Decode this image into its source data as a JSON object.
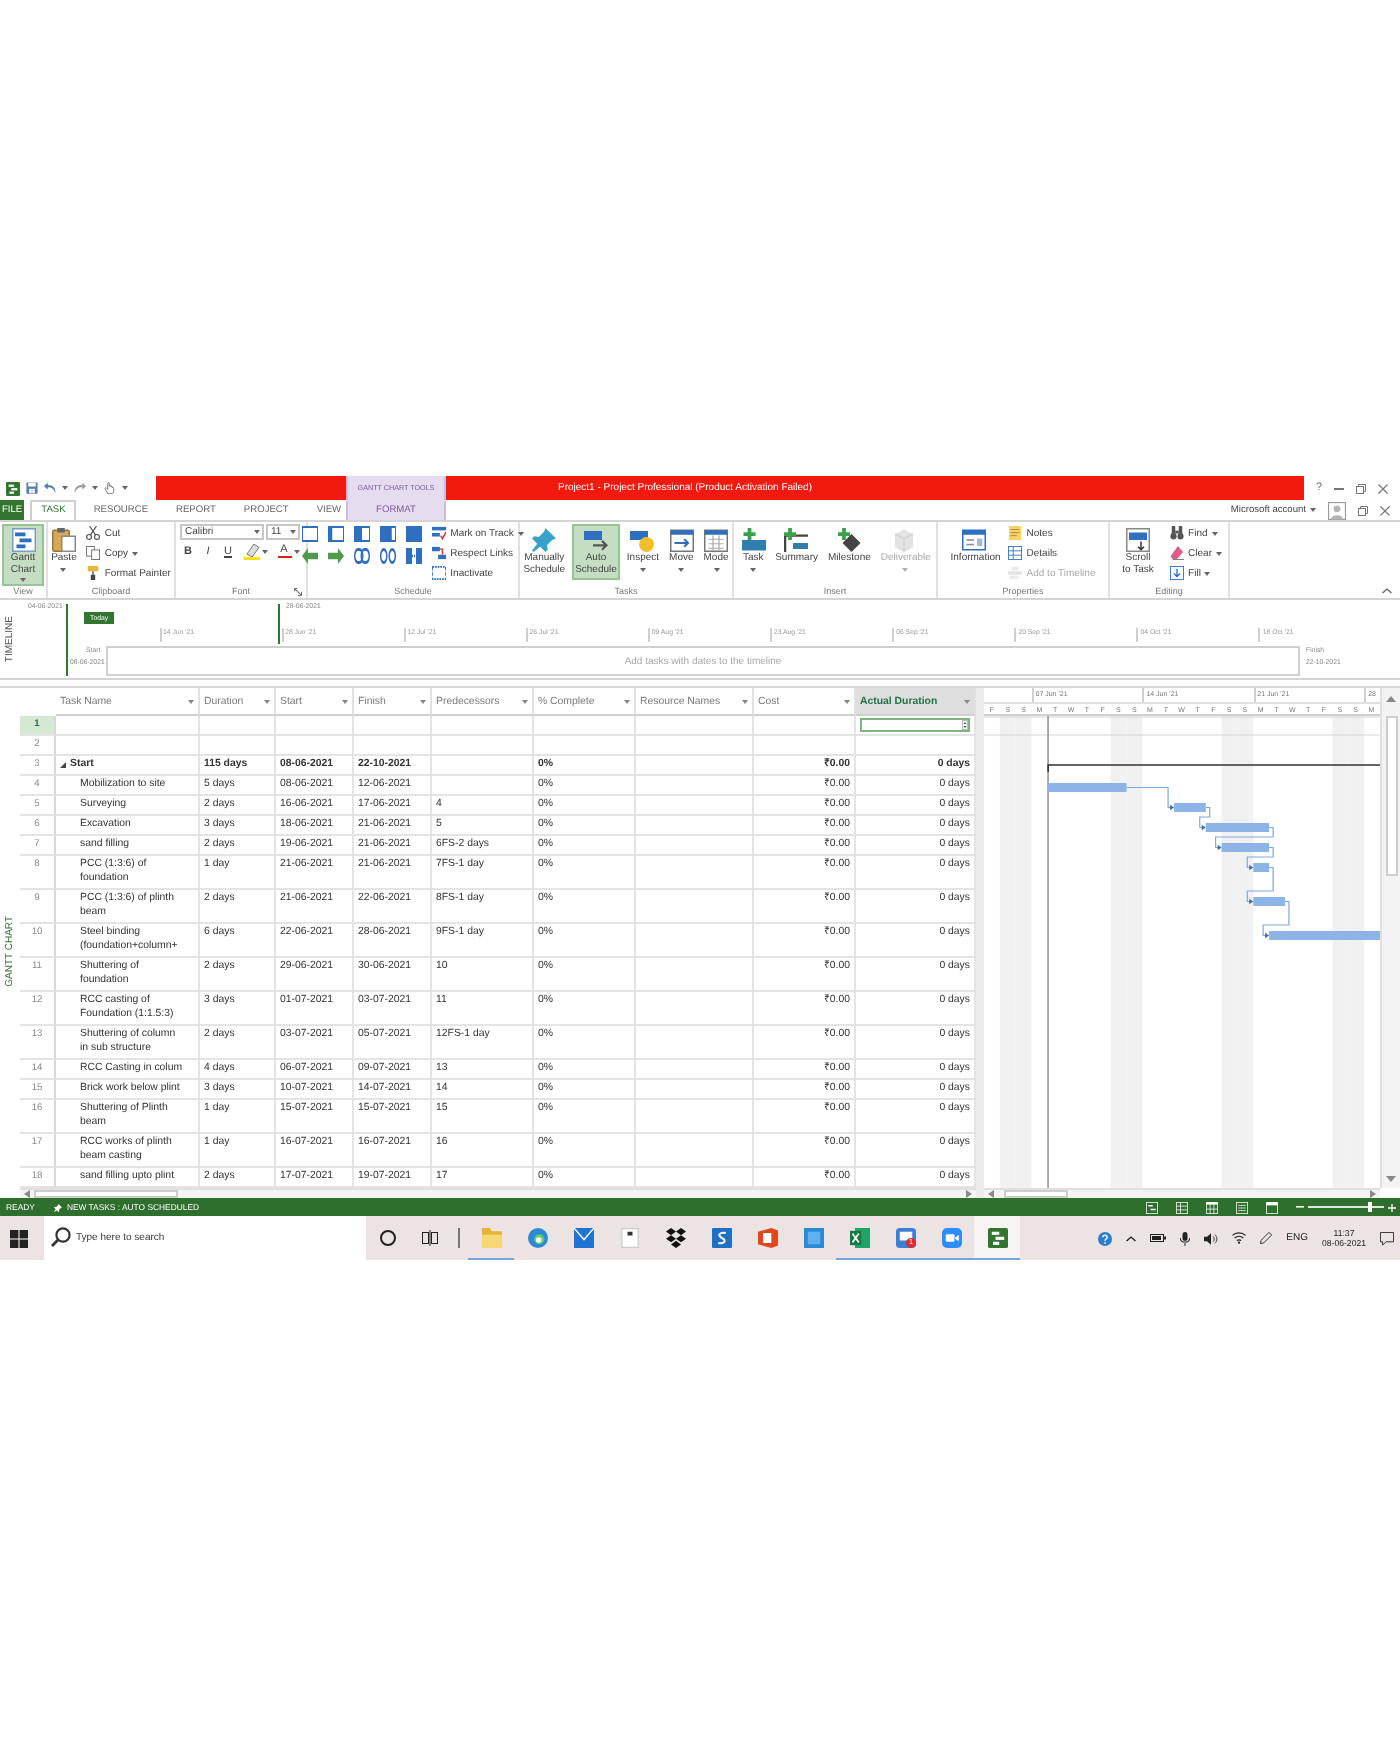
{
  "title_bar": {
    "contextual_group": "GANTT CHART TOOLS",
    "title": "Project1 - Project Professional (Product Activation Failed)",
    "help": "?"
  },
  "ribbon_tabs": [
    {
      "label": "FILE",
      "kind": "file",
      "selected": false
    },
    {
      "label": "TASK",
      "kind": "tab",
      "selected": true
    },
    {
      "label": "RESOURCE",
      "kind": "tab",
      "selected": false
    },
    {
      "label": "REPORT",
      "kind": "tab",
      "selected": false
    },
    {
      "label": "PROJECT",
      "kind": "tab",
      "selected": false
    },
    {
      "label": "VIEW",
      "kind": "tab",
      "selected": false
    },
    {
      "label": "FORMAT",
      "kind": "contextual",
      "selected": false
    }
  ],
  "account": {
    "label": "Microsoft account"
  },
  "ribbon": {
    "groups": [
      {
        "label": "View",
        "launcher": false,
        "columns": [
          [
            {
              "kind": "large",
              "label": "Gantt Chart",
              "menu": true,
              "on": true,
              "disabled": false
            }
          ]
        ]
      },
      {
        "label": "Clipboard",
        "launcher": false,
        "columns": [
          [
            {
              "kind": "large",
              "label": "Paste",
              "menu": true,
              "on": false,
              "disabled": false
            }
          ],
          [
            {
              "kind": "small",
              "label": "Cut",
              "menu": false,
              "on": false,
              "disabled": false
            },
            {
              "kind": "small",
              "label": "Copy",
              "menu": true,
              "on": false,
              "disabled": false
            },
            {
              "kind": "small",
              "label": "Format Painter",
              "menu": false,
              "on": false,
              "disabled": false
            }
          ]
        ]
      },
      {
        "label": "Font",
        "launcher": true,
        "columns": [
          [
            {
              "kind": "row",
              "items": [
                {
                  "kind": "combo",
                  "value": "Calibri"
                },
                {
                  "kind": "combo",
                  "value": "11"
                }
              ]
            },
            {
              "kind": "row",
              "items": [
                {
                  "kind": "bold",
                  "label": "B"
                },
                {
                  "kind": "italic",
                  "label": "I"
                },
                {
                  "kind": "underline",
                  "label": "U"
                },
                {
                  "kind": "icon",
                  "menu": true
                },
                {
                  "kind": "font-color",
                  "label": "A",
                  "menu": true
                }
              ]
            }
          ]
        ]
      },
      {
        "label": "Schedule",
        "launcher": false,
        "columns": [
          [
            {
              "kind": "row",
              "items": [
                {
                  "kind": "icon",
                  "menu": false
                },
                {
                  "kind": "icon",
                  "menu": false
                },
                {
                  "kind": "icon",
                  "menu": false
                },
                {
                  "kind": "icon",
                  "menu": false
                },
                {
                  "kind": "icon",
                  "menu": false
                }
              ]
            },
            {
              "kind": "row",
              "items": [
                {
                  "kind": "icon",
                  "menu": false
                },
                {
                  "kind": "icon",
                  "menu": false
                },
                {
                  "kind": "icon",
                  "menu": false
                },
                {
                  "kind": "icon",
                  "menu": false
                },
                {
                  "kind": "icon",
                  "menu": false
                }
              ]
            }
          ],
          [
            {
              "kind": "small",
              "label": "Mark on Track",
              "menu": true,
              "on": false,
              "disabled": false
            },
            {
              "kind": "small",
              "label": "Respect Links",
              "menu": false,
              "on": false,
              "disabled": false
            },
            {
              "kind": "small",
              "label": "Inactivate",
              "menu": false,
              "on": false,
              "disabled": false
            }
          ]
        ]
      },
      {
        "label": "Tasks",
        "launcher": false,
        "columns": [
          [
            {
              "kind": "large",
              "label": "Manually Schedule",
              "menu": false,
              "on": false,
              "disabled": false
            }
          ],
          [
            {
              "kind": "large",
              "label": "Auto Schedule",
              "menu": false,
              "on": true,
              "disabled": false
            }
          ],
          [
            {
              "kind": "large",
              "label": "Inspect",
              "menu": true,
              "on": false,
              "disabled": false
            }
          ],
          [
            {
              "kind": "large",
              "label": "Move",
              "menu": true,
              "on": false,
              "disabled": false
            }
          ],
          [
            {
              "kind": "large",
              "label": "Mode",
              "menu": true,
              "on": false,
              "disabled": false
            }
          ]
        ]
      },
      {
        "label": "Insert",
        "launcher": false,
        "columns": [
          [
            {
              "kind": "large",
              "label": "Task",
              "menu": true,
              "on": false,
              "disabled": false
            }
          ],
          [
            {
              "kind": "large",
              "label": "Summary",
              "menu": false,
              "on": false,
              "disabled": false
            }
          ],
          [
            {
              "kind": "large",
              "label": "Milestone",
              "menu": false,
              "on": false,
              "disabled": false
            }
          ],
          [
            {
              "kind": "large",
              "label": "Deliverable",
              "menu": true,
              "on": false,
              "disabled": true
            }
          ]
        ]
      },
      {
        "label": "Properties",
        "launcher": false,
        "columns": [
          [
            {
              "kind": "large",
              "label": "Information",
              "menu": false,
              "on": false,
              "disabled": false
            }
          ],
          [
            {
              "kind": "small",
              "label": "Notes",
              "menu": false,
              "on": false,
              "disabled": false
            },
            {
              "kind": "small",
              "label": "Details",
              "menu": false,
              "on": false,
              "disabled": false
            },
            {
              "kind": "small",
              "label": "Add to Timeline",
              "menu": false,
              "on": false,
              "disabled": true
            }
          ]
        ]
      },
      {
        "label": "Editing",
        "launcher": false,
        "columns": [
          [
            {
              "kind": "large",
              "label": "Scroll to Task",
              "menu": false,
              "on": false,
              "disabled": false
            }
          ],
          [
            {
              "kind": "small",
              "label": "Find",
              "menu": true,
              "on": false,
              "disabled": false
            },
            {
              "kind": "small",
              "label": "Clear",
              "menu": true,
              "on": false,
              "disabled": false
            },
            {
              "kind": "small",
              "label": "Fill",
              "menu": true,
              "on": false,
              "disabled": false
            }
          ]
        ]
      }
    ]
  },
  "timeline": {
    "label": "TIMELINE",
    "range_start": "04-06-2021",
    "range_end": "28-06-2021",
    "today": "Today",
    "ticks": [
      "14 Jun '21",
      "28 Jun '21",
      "12 Jul '21",
      "26 Jul '21",
      "09 Aug '21",
      "23 Aug '21",
      "06 Sep '21",
      "20 Sep '21",
      "04 Oct '21",
      "18 Oct '21"
    ],
    "start_label": "Start",
    "start_date": "08-06-2021",
    "hint": "Add tasks with dates to the timeline",
    "finish_label": "Finish",
    "finish_date": "22-10-2021"
  },
  "sheet": {
    "view_label": "GANTT CHART",
    "columns": [
      {
        "label": "Task Name",
        "selected": false
      },
      {
        "label": "Duration",
        "selected": false
      },
      {
        "label": "Start",
        "selected": false
      },
      {
        "label": "Finish",
        "selected": false
      },
      {
        "label": "Predecessors",
        "selected": false
      },
      {
        "label": "% Complete",
        "selected": false
      },
      {
        "label": "Resource Names",
        "selected": false
      },
      {
        "label": "Cost",
        "selected": false
      },
      {
        "label": "Actual Duration",
        "selected": true
      }
    ],
    "rows": [
      {
        "number": "1",
        "kind": "blank",
        "selected": true
      },
      {
        "number": "2",
        "kind": "blank",
        "selected": false
      },
      {
        "number": "3",
        "kind": "summary",
        "selected": false,
        "expanded": true,
        "name": "Start",
        "duration": "115 days",
        "start": "08-06-2021",
        "finish": "22-10-2021",
        "complete": "0%",
        "cost": "₹0.00",
        "actual_duration": "0 days",
        "children": [
          {
            "number": "4",
            "kind": "task",
            "selected": false,
            "name": "Mobilization to site",
            "duration": "5 days",
            "start": "08-06-2021",
            "finish": "12-06-2021",
            "complete": "0%",
            "cost": "₹0.00",
            "actual_duration": "0 days"
          },
          {
            "number": "5",
            "kind": "task",
            "selected": false,
            "name": "Surveying",
            "duration": "2 days",
            "start": "16-06-2021",
            "finish": "17-06-2021",
            "predecessors": "4",
            "complete": "0%",
            "cost": "₹0.00",
            "actual_duration": "0 days"
          },
          {
            "number": "6",
            "kind": "task",
            "selected": false,
            "name": "Excavation",
            "duration": "3 days",
            "start": "18-06-2021",
            "finish": "21-06-2021",
            "predecessors": "5",
            "complete": "0%",
            "cost": "₹0.00",
            "actual_duration": "0 days"
          },
          {
            "number": "7",
            "kind": "task",
            "selected": false,
            "name": "sand filling",
            "duration": "2 days",
            "start": "19-06-2021",
            "finish": "21-06-2021",
            "predecessors": "6FS-2 days",
            "complete": "0%",
            "cost": "₹0.00",
            "actual_duration": "0 days"
          },
          {
            "number": "8",
            "kind": "task",
            "selected": false,
            "name": "PCC (1:3:6) of foundation",
            "duration": "1 day",
            "start": "21-06-2021",
            "finish": "21-06-2021",
            "predecessors": "7FS-1 day",
            "complete": "0%",
            "cost": "₹0.00",
            "actual_duration": "0 days"
          },
          {
            "number": "9",
            "kind": "task",
            "selected": false,
            "name": "PCC (1:3:6) of plinth beam",
            "duration": "2 days",
            "start": "21-06-2021",
            "finish": "22-06-2021",
            "predecessors": "8FS-1 day",
            "complete": "0%",
            "cost": "₹0.00",
            "actual_duration": "0 days"
          },
          {
            "number": "10",
            "kind": "task",
            "selected": false,
            "name": "Steel binding (foundation+column+",
            "duration": "6 days",
            "start": "22-06-2021",
            "finish": "28-06-2021",
            "predecessors": "9FS-1 day",
            "complete": "0%",
            "cost": "₹0.00",
            "actual_duration": "0 days"
          },
          {
            "number": "11",
            "kind": "task",
            "selected": false,
            "name": "Shuttering of foundation",
            "duration": "2 days",
            "start": "29-06-2021",
            "finish": "30-06-2021",
            "predecessors": "10",
            "complete": "0%",
            "cost": "₹0.00",
            "actual_duration": "0 days"
          },
          {
            "number": "12",
            "kind": "task",
            "selected": false,
            "name": "RCC casting of Foundation (1:1.5:3)",
            "duration": "3 days",
            "start": "01-07-2021",
            "finish": "03-07-2021",
            "predecessors": "11",
            "complete": "0%",
            "cost": "₹0.00",
            "actual_duration": "0 days"
          },
          {
            "number": "13",
            "kind": "task",
            "selected": false,
            "name": "Shuttering of column in sub structure",
            "duration": "2 days",
            "start": "03-07-2021",
            "finish": "05-07-2021",
            "predecessors": "12FS-1 day",
            "complete": "0%",
            "cost": "₹0.00",
            "actual_duration": "0 days"
          },
          {
            "number": "14",
            "kind": "task",
            "selected": false,
            "name": "RCC Casting in colum",
            "duration": "4 days",
            "start": "06-07-2021",
            "finish": "09-07-2021",
            "predecessors": "13",
            "complete": "0%",
            "cost": "₹0.00",
            "actual_duration": "0 days"
          },
          {
            "number": "15",
            "kind": "task",
            "selected": false,
            "name": "Brick work below plint",
            "duration": "3 days",
            "start": "10-07-2021",
            "finish": "14-07-2021",
            "predecessors": "14",
            "complete": "0%",
            "cost": "₹0.00",
            "actual_duration": "0 days"
          },
          {
            "number": "16",
            "kind": "task",
            "selected": false,
            "name": "Shuttering of Plinth beam",
            "duration": "1 day",
            "start": "15-07-2021",
            "finish": "15-07-2021",
            "predecessors": "15",
            "complete": "0%",
            "cost": "₹0.00",
            "actual_duration": "0 days"
          },
          {
            "number": "17",
            "kind": "task",
            "selected": false,
            "name": "RCC works of plinth beam casting",
            "duration": "1 day",
            "start": "16-07-2021",
            "finish": "16-07-2021",
            "predecessors": "16",
            "complete": "0%",
            "cost": "₹0.00",
            "actual_duration": "0 days"
          },
          {
            "number": "18",
            "kind": "task",
            "selected": false,
            "name": "sand filling upto plint",
            "duration": "2 days",
            "start": "17-07-2021",
            "finish": "19-07-2021",
            "predecessors": "17",
            "complete": "0%",
            "cost": "₹0.00",
            "actual_duration": "0 days"
          }
        ]
      }
    ]
  },
  "gantt": {
    "weeks": [
      "07 Jun '21",
      "14 Jun '21",
      "21 Jun '21",
      "28"
    ],
    "days": [
      {
        "letter": "F",
        "weekend": false
      },
      {
        "letter": "S",
        "weekend": true
      },
      {
        "letter": "S",
        "weekend": true
      },
      {
        "letter": "M",
        "weekend": false
      },
      {
        "letter": "T",
        "weekend": false
      },
      {
        "letter": "W",
        "weekend": false
      },
      {
        "letter": "T",
        "weekend": false
      },
      {
        "letter": "F",
        "weekend": false
      },
      {
        "letter": "S",
        "weekend": true
      },
      {
        "letter": "S",
        "weekend": true
      },
      {
        "letter": "M",
        "weekend": false
      },
      {
        "letter": "T",
        "weekend": false
      },
      {
        "letter": "W",
        "weekend": false
      },
      {
        "letter": "T",
        "weekend": false
      },
      {
        "letter": "F",
        "weekend": false
      },
      {
        "letter": "S",
        "weekend": true
      },
      {
        "letter": "S",
        "weekend": true
      },
      {
        "letter": "M",
        "weekend": false
      },
      {
        "letter": "T",
        "weekend": false
      },
      {
        "letter": "W",
        "weekend": false
      },
      {
        "letter": "T",
        "weekend": false
      },
      {
        "letter": "F",
        "weekend": false
      },
      {
        "letter": "S",
        "weekend": true
      },
      {
        "letter": "S",
        "weekend": true
      },
      {
        "letter": "M",
        "weekend": false
      }
    ]
  },
  "status_bar": {
    "mode": "READY",
    "task_mode": "NEW TASKS : AUTO SCHEDULED",
    "zoom": {
      "level": 0.82
    }
  },
  "taskbar": {
    "search": {
      "placeholder": "Type here to search"
    },
    "apps": [
      {
        "running": true,
        "active": false
      },
      {
        "running": false,
        "active": false
      },
      {
        "running": false,
        "active": false
      },
      {
        "running": false,
        "active": false
      },
      {
        "running": false,
        "active": false
      },
      {
        "running": false,
        "active": false
      },
      {
        "running": false,
        "active": false
      },
      {
        "running": false,
        "active": false
      },
      {
        "running": true,
        "active": false
      },
      {
        "running": true,
        "active": false,
        "badge": "1"
      },
      {
        "running": true,
        "active": false
      },
      {
        "running": true,
        "active": true
      }
    ],
    "language": "ENG",
    "time": "11:37",
    "date": "08-06-2021"
  }
}
